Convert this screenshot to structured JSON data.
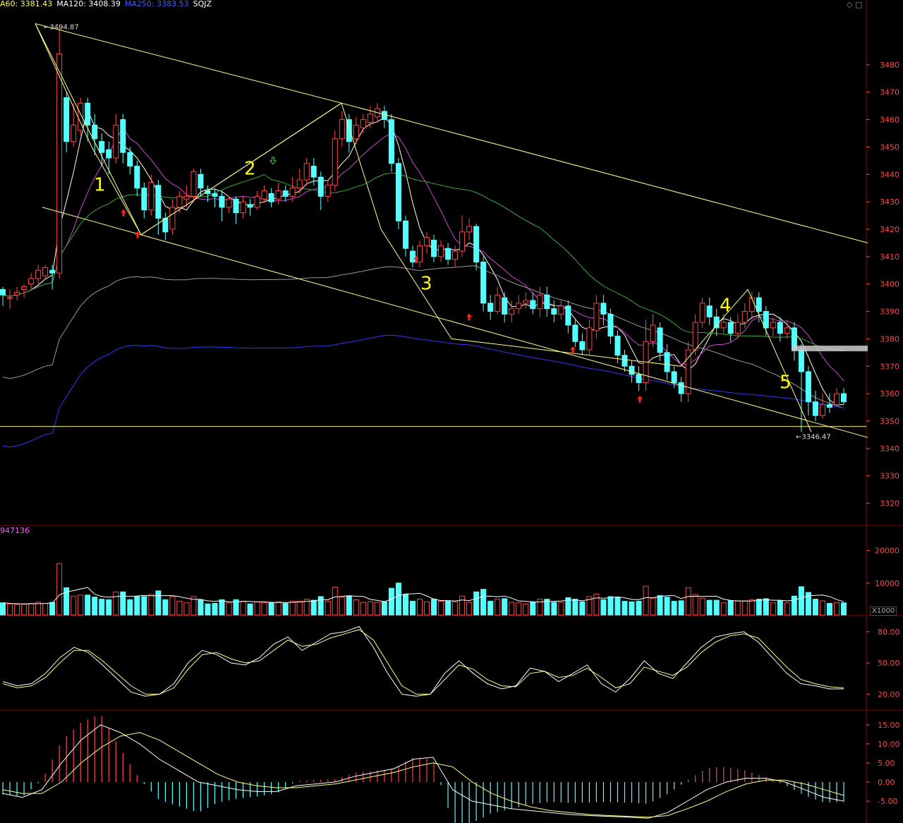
{
  "header": {
    "ma60": "A60: 3381.43",
    "ma120": "MA120: 3408.39",
    "ma250": "MA250: 3383.53",
    "name": "SQJZ"
  },
  "colors": {
    "background": "#000000",
    "up": "#ff4444",
    "down": "#54ffff",
    "trendline": "#ffff80",
    "ma_pink": "#cc44cc",
    "ma_green": "#33aa33",
    "ma_gray": "#999999",
    "ma_blue": "#3333ff",
    "axis_label": "#ff4444",
    "panel_border": "#880000",
    "wave_label": "#ffff00"
  },
  "volume_header": "947136",
  "volume_unit": "X1000",
  "annotations": {
    "high_label": "3494.87",
    "low_label": "3346.47",
    "wave_labels": [
      "1",
      "2",
      "3",
      "4",
      "5"
    ]
  },
  "chart_data": [
    {
      "type": "candlestick",
      "panel": "price",
      "yticks": [
        3320,
        3330,
        3340,
        3350,
        3360,
        3370,
        3380,
        3390,
        3400,
        3410,
        3420,
        3430,
        3440,
        3450,
        3460,
        3470,
        3480
      ],
      "ylim": [
        3315,
        3499
      ],
      "candles": [
        [
          3398,
          3396,
          3399,
          3392
        ],
        [
          3395,
          3395,
          3398,
          3391
        ],
        [
          3396,
          3397,
          3399,
          3394
        ],
        [
          3398,
          3399,
          3400,
          3395
        ],
        [
          3400,
          3402,
          3404,
          3398
        ],
        [
          3402,
          3405,
          3407,
          3400
        ],
        [
          3403,
          3406,
          3407,
          3402
        ],
        [
          3405,
          3404,
          3407,
          3398
        ],
        [
          3404,
          3484,
          3494,
          3402
        ],
        [
          3468,
          3452,
          3470,
          3448
        ],
        [
          3452,
          3458,
          3466,
          3450
        ],
        [
          3456,
          3466,
          3468,
          3454
        ],
        [
          3466,
          3458,
          3468,
          3452
        ],
        [
          3458,
          3453,
          3462,
          3447
        ],
        [
          3452,
          3448,
          3455,
          3443
        ],
        [
          3449,
          3446,
          3452,
          3440
        ],
        [
          3446,
          3458,
          3462,
          3444
        ],
        [
          3460,
          3448,
          3462,
          3444
        ],
        [
          3448,
          3443,
          3450,
          3440
        ],
        [
          3443,
          3435,
          3445,
          3432
        ],
        [
          3435,
          3427,
          3437,
          3424
        ],
        [
          3427,
          3437,
          3440,
          3425
        ],
        [
          3436,
          3424,
          3438,
          3418
        ],
        [
          3424,
          3419,
          3426,
          3416
        ],
        [
          3420,
          3428,
          3431,
          3418
        ],
        [
          3428,
          3432,
          3434,
          3426
        ],
        [
          3431,
          3432,
          3436,
          3428
        ],
        [
          3432,
          3441,
          3442,
          3430
        ],
        [
          3440,
          3435,
          3442,
          3432
        ],
        [
          3434,
          3433,
          3436,
          3430
        ],
        [
          3433,
          3432,
          3435,
          3428
        ],
        [
          3432,
          3428,
          3434,
          3423
        ],
        [
          3428,
          3431,
          3432,
          3426
        ],
        [
          3431,
          3426,
          3432,
          3422
        ],
        [
          3426,
          3430,
          3432,
          3424
        ],
        [
          3429,
          3428,
          3431,
          3425
        ],
        [
          3428,
          3432,
          3434,
          3427
        ],
        [
          3431,
          3434,
          3436,
          3430
        ],
        [
          3433,
          3430,
          3435,
          3428
        ],
        [
          3431,
          3434,
          3437,
          3429
        ],
        [
          3434,
          3432,
          3436,
          3430
        ],
        [
          3432,
          3435,
          3439,
          3430
        ],
        [
          3435,
          3438,
          3442,
          3433
        ],
        [
          3438,
          3444,
          3446,
          3436
        ],
        [
          3443,
          3439,
          3446,
          3436
        ],
        [
          3439,
          3432,
          3441,
          3427
        ],
        [
          3432,
          3436,
          3438,
          3430
        ],
        [
          3436,
          3453,
          3456,
          3434
        ],
        [
          3453,
          3460,
          3463,
          3450
        ],
        [
          3460,
          3452,
          3462,
          3448
        ],
        [
          3453,
          3458,
          3461,
          3451
        ],
        [
          3457,
          3460,
          3462,
          3455
        ],
        [
          3459,
          3462,
          3465,
          3457
        ],
        [
          3461,
          3464,
          3466,
          3459
        ],
        [
          3463,
          3460,
          3465,
          3457
        ],
        [
          3460,
          3444,
          3462,
          3441
        ],
        [
          3444,
          3423,
          3446,
          3420
        ],
        [
          3423,
          3413,
          3425,
          3410
        ],
        [
          3412,
          3408,
          3414,
          3406
        ],
        [
          3408,
          3414,
          3416,
          3406
        ],
        [
          3414,
          3417,
          3419,
          3411
        ],
        [
          3416,
          3410,
          3418,
          3408
        ],
        [
          3410,
          3414,
          3416,
          3408
        ],
        [
          3413,
          3409,
          3415,
          3407
        ],
        [
          3409,
          3412,
          3414,
          3406
        ],
        [
          3412,
          3419,
          3425,
          3410
        ],
        [
          3419,
          3421,
          3424,
          3416
        ],
        [
          3421,
          3408,
          3422,
          3405
        ],
        [
          3408,
          3393,
          3410,
          3390
        ],
        [
          3393,
          3390,
          3396,
          3387
        ],
        [
          3390,
          3396,
          3399,
          3389
        ],
        [
          3395,
          3389,
          3397,
          3386
        ],
        [
          3389,
          3391,
          3394,
          3386
        ],
        [
          3391,
          3393,
          3396,
          3389
        ],
        [
          3393,
          3394,
          3397,
          3391
        ],
        [
          3394,
          3391,
          3397,
          3389
        ],
        [
          3391,
          3396,
          3399,
          3388
        ],
        [
          3396,
          3391,
          3399,
          3388
        ],
        [
          3391,
          3389,
          3394,
          3386
        ],
        [
          3389,
          3392,
          3394,
          3387
        ],
        [
          3392,
          3385,
          3394,
          3382
        ],
        [
          3385,
          3379,
          3387,
          3377
        ],
        [
          3379,
          3376,
          3382,
          3374
        ],
        [
          3376,
          3384,
          3387,
          3374
        ],
        [
          3383,
          3393,
          3396,
          3380
        ],
        [
          3393,
          3389,
          3396,
          3385
        ],
        [
          3389,
          3381,
          3391,
          3378
        ],
        [
          3381,
          3374,
          3383,
          3371
        ],
        [
          3374,
          3370,
          3376,
          3368
        ],
        [
          3370,
          3367,
          3372,
          3364
        ],
        [
          3367,
          3364,
          3370,
          3361
        ],
        [
          3364,
          3379,
          3387,
          3361
        ],
        [
          3379,
          3385,
          3389,
          3377
        ],
        [
          3384,
          3375,
          3386,
          3372
        ],
        [
          3375,
          3368,
          3378,
          3365
        ],
        [
          3368,
          3364,
          3370,
          3362
        ],
        [
          3364,
          3360,
          3366,
          3357
        ],
        [
          3360,
          3376,
          3379,
          3357
        ],
        [
          3376,
          3386,
          3389,
          3374
        ],
        [
          3386,
          3393,
          3395,
          3384
        ],
        [
          3392,
          3388,
          3395,
          3385
        ],
        [
          3388,
          3384,
          3391,
          3381
        ],
        [
          3384,
          3386,
          3389,
          3382
        ],
        [
          3386,
          3382,
          3388,
          3379
        ],
        [
          3382,
          3386,
          3389,
          3380
        ],
        [
          3386,
          3390,
          3393,
          3384
        ],
        [
          3390,
          3395,
          3397,
          3387
        ],
        [
          3395,
          3390,
          3397,
          3386
        ],
        [
          3390,
          3384,
          3392,
          3381
        ],
        [
          3384,
          3386,
          3388,
          3381
        ],
        [
          3386,
          3382,
          3388,
          3379
        ],
        [
          3382,
          3384,
          3387,
          3380
        ],
        [
          3384,
          3376,
          3386,
          3372
        ],
        [
          3376,
          3368,
          3378,
          3346
        ],
        [
          3368,
          3357,
          3370,
          3352
        ],
        [
          3357,
          3352,
          3361,
          3350
        ],
        [
          3352,
          3356,
          3360,
          3351
        ],
        [
          3356,
          3355,
          3360,
          3353
        ],
        [
          3356,
          3360,
          3362,
          3356
        ],
        [
          3360,
          3357,
          3362,
          3356
        ]
      ],
      "trendlines": [
        [
          [
            50,
            3495
          ],
          [
            484,
            3466
          ],
          [
            1230,
            3415
          ]
        ],
        [
          [
            60,
            3428
          ],
          [
            1230,
            3344
          ]
        ],
        [
          [
            50,
            3495
          ],
          [
            200,
            3418
          ]
        ],
        [
          [
            50,
            3495
          ],
          [
            130,
            3450
          ],
          [
            200,
            3418
          ],
          [
            484,
            3466
          ],
          [
            540,
            3420
          ],
          [
            640,
            3380
          ],
          [
            965,
            3370
          ],
          [
            1060,
            3398
          ],
          [
            1150,
            3346
          ]
        ],
        [
          [
            200,
            3418
          ],
          [
            484,
            3466
          ]
        ]
      ],
      "hline": 3348,
      "wave_positions": [
        [
          133,
          3434
        ],
        [
          346,
          3440
        ],
        [
          596,
          3398
        ],
        [
          1020,
          3390
        ],
        [
          1105,
          3362
        ]
      ],
      "marker_down": [
        [
          175,
          3426
        ],
        [
          195,
          3418
        ],
        [
          590,
          3409
        ],
        [
          665,
          3388
        ],
        [
          812,
          3376
        ],
        [
          907,
          3358
        ]
      ],
      "marker_up": [
        [
          387,
          3445
        ]
      ]
    },
    {
      "type": "bar",
      "panel": "volume",
      "yticks": [
        10000,
        20000
      ],
      "ylim": [
        0,
        26000
      ]
    },
    {
      "type": "line",
      "panel": "oscillator",
      "yticks": [
        20.0,
        50.0,
        80.0
      ],
      "ylim": [
        10,
        90
      ],
      "series": [
        {
          "color": "#ffffff",
          "values": [
            32,
            28,
            30,
            40,
            55,
            65,
            60,
            48,
            35,
            22,
            18,
            20,
            30,
            50,
            62,
            58,
            50,
            48,
            55,
            68,
            75,
            62,
            70,
            78,
            80,
            85,
            65,
            40,
            20,
            18,
            20,
            40,
            52,
            40,
            30,
            25,
            28,
            45,
            42,
            32,
            40,
            48,
            30,
            22,
            35,
            52,
            40,
            35,
            50,
            65,
            75,
            78,
            80,
            70,
            55,
            40,
            30,
            28,
            25,
            25
          ]
        },
        {
          "color": "#ffff80",
          "values": [
            30,
            26,
            28,
            36,
            50,
            62,
            62,
            52,
            40,
            28,
            20,
            20,
            26,
            44,
            58,
            60,
            54,
            50,
            52,
            62,
            72,
            66,
            68,
            74,
            78,
            82,
            72,
            50,
            28,
            20,
            20,
            34,
            48,
            44,
            34,
            28,
            27,
            40,
            42,
            36,
            38,
            45,
            36,
            26,
            30,
            46,
            42,
            38,
            46,
            60,
            70,
            76,
            78,
            74,
            60,
            46,
            34,
            30,
            27,
            26
          ]
        }
      ]
    },
    {
      "type": "macd",
      "panel": "macd",
      "yticks": [
        -5.0,
        0.0,
        5.0,
        10.0,
        15.0
      ],
      "ylim": [
        -10,
        17
      ],
      "dif": [
        -3,
        -4,
        -2,
        5,
        11,
        15,
        13,
        10,
        6,
        3,
        0,
        -1,
        -2,
        -2.5,
        -2.5,
        -1,
        -0.5,
        0,
        1.5,
        2.5,
        3.5,
        6,
        6.5,
        -2,
        -5,
        -6,
        -7,
        -7.5,
        -8,
        -8.5,
        -8.8,
        -9,
        -9.2,
        -9.5,
        -8,
        -5,
        -2,
        0,
        1,
        1,
        0,
        -2,
        -4,
        -5
      ],
      "dea": [
        -2,
        -3,
        -3,
        0,
        5,
        9,
        12,
        13,
        11,
        8,
        5,
        2,
        0,
        -1,
        -1.5,
        -1.5,
        -1,
        -0.5,
        0.5,
        1.5,
        2.5,
        4,
        5,
        4,
        0,
        -3,
        -5,
        -6.5,
        -7.5,
        -8,
        -8.5,
        -8.8,
        -9,
        -9.2,
        -8.8,
        -7,
        -5,
        -2.5,
        -0.5,
        0.5,
        0.5,
        -0.5,
        -2,
        -3.5
      ]
    }
  ]
}
